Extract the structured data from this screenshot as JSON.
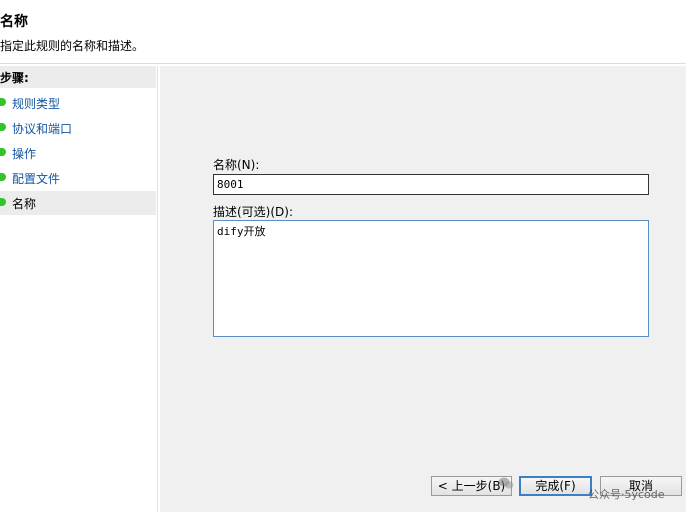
{
  "header": {
    "title": "名称",
    "subtitle": "指定此规则的名称和描述。"
  },
  "sidebar": {
    "heading": "步骤:",
    "items": [
      {
        "label": "规则类型"
      },
      {
        "label": "协议和端口"
      },
      {
        "label": "操作"
      },
      {
        "label": "配置文件"
      },
      {
        "label": "名称"
      }
    ],
    "current_index": 4
  },
  "form": {
    "name_label": "名称(N):",
    "name_value": "8001",
    "desc_label": "描述(可选)(D):",
    "desc_value": "dify开放"
  },
  "buttons": {
    "back": "< 上一步(B)",
    "finish": "完成(F)",
    "cancel": "取消"
  },
  "watermark": {
    "text": "公众号·5ycode"
  },
  "colors": {
    "step_dot": "#33c42c",
    "step_link": "#1556a0",
    "default_button_border": "#3c7fc4"
  }
}
